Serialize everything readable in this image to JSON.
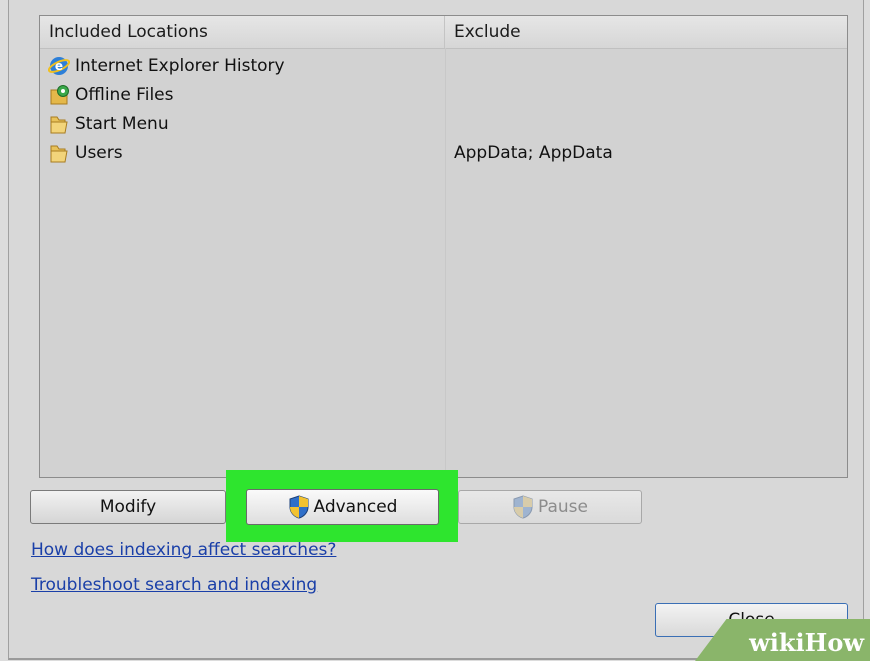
{
  "list": {
    "headers": {
      "included": "Included Locations",
      "exclude": "Exclude"
    },
    "rows": [
      {
        "name": "Internet Explorer History",
        "icon": "ie-icon",
        "exclude": ""
      },
      {
        "name": "Offline Files",
        "icon": "offline-files-icon",
        "exclude": ""
      },
      {
        "name": "Start Menu",
        "icon": "folder-icon",
        "exclude": ""
      },
      {
        "name": "Users",
        "icon": "folder-icon",
        "exclude": "AppData; AppData"
      }
    ]
  },
  "buttons": {
    "modify": "Modify",
    "advanced": "Advanced",
    "pause": "Pause",
    "close": "Close"
  },
  "links": {
    "indexing": "How does indexing affect searches?",
    "troubleshoot": "Troubleshoot search and indexing"
  },
  "watermark": "wikiHow",
  "colors": {
    "highlight": "#2ee52e",
    "link": "#1a3fa8"
  }
}
